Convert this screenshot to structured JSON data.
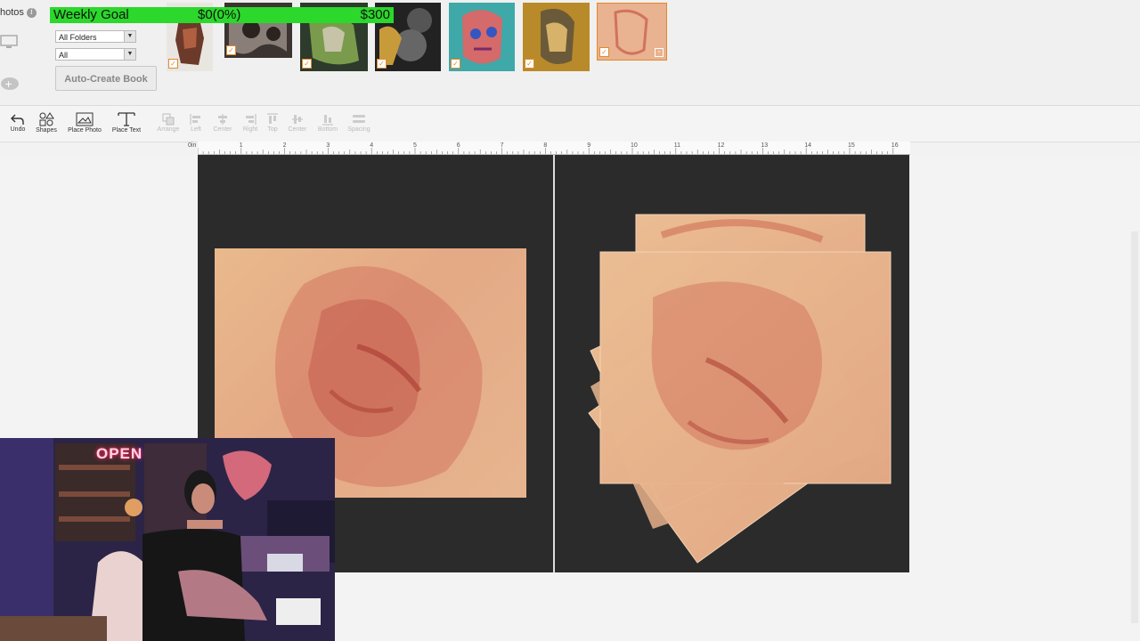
{
  "photos_panel": {
    "title": "hotos",
    "folder_dropdown": "All Folders",
    "filter_dropdown": "All",
    "auto_create_button": "Auto-Create Book"
  },
  "goal": {
    "label": "Weekly Goal",
    "current": "$0(0%)",
    "target": "$300",
    "progress_fraction": 0
  },
  "toolbar": {
    "undo": "Undo",
    "shapes": "Shapes",
    "place_photo": "Place Photo",
    "place_text": "Place Text",
    "arrange": "Arrange",
    "left": "Left",
    "center": "Center",
    "right": "Right",
    "top": "Top",
    "center2": "Center",
    "bottom": "Bottom",
    "spacing": "Spacing"
  },
  "ruler": {
    "labels": [
      "0in",
      "1",
      "2",
      "3",
      "4",
      "5",
      "6",
      "7",
      "8",
      "9",
      "10",
      "11",
      "12",
      "13",
      "14",
      "15",
      "16"
    ]
  },
  "stream": {
    "sign": "OPEN"
  },
  "colors": {
    "goal_green": "#2bd82b",
    "page_dark": "#2b2b2b",
    "checkbox_orange": "#e08a2c"
  }
}
